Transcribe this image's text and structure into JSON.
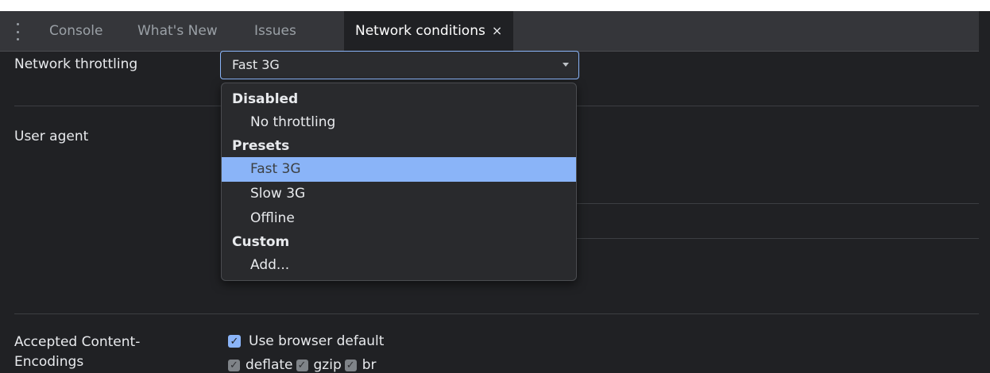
{
  "tabs": [
    {
      "label": "Console",
      "active": false
    },
    {
      "label": "What's New",
      "active": false
    },
    {
      "label": "Issues",
      "active": false
    },
    {
      "label": "Network conditions",
      "active": true,
      "close": "×"
    }
  ],
  "network_throttling": {
    "label": "Network throttling",
    "selected_value": "Fast 3G",
    "dropdown": {
      "groups": [
        {
          "label": "Disabled",
          "items": [
            "No throttling"
          ]
        },
        {
          "label": "Presets",
          "items": [
            "Fast 3G",
            "Slow 3G",
            "Offline"
          ]
        },
        {
          "label": "Custom",
          "items": [
            "Add..."
          ]
        }
      ],
      "highlighted": "Fast 3G"
    }
  },
  "user_agent": {
    "label": "User agent"
  },
  "accepted_encodings": {
    "label_line1": "Accepted Content-",
    "label_line2": "Encodings",
    "use_browser_default": {
      "label": "Use browser default",
      "checked": true
    },
    "options": [
      {
        "label": "deflate",
        "checked": true,
        "disabled": true
      },
      {
        "label": "gzip",
        "checked": true,
        "disabled": true
      },
      {
        "label": "br",
        "checked": true,
        "disabled": true
      }
    ]
  },
  "colors": {
    "background": "#202124",
    "tabbar": "#35363a",
    "accent": "#8ab4f8"
  }
}
